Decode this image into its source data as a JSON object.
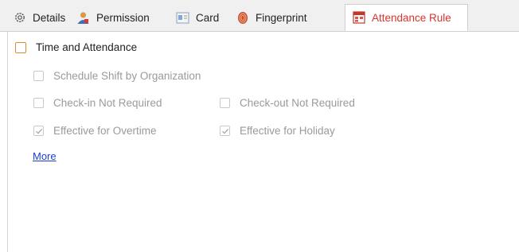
{
  "tabs": [
    {
      "label": "Details",
      "icon": "gear-icon"
    },
    {
      "label": "Permission",
      "icon": "user-permission-icon"
    },
    {
      "label": "Card",
      "icon": "card-icon"
    },
    {
      "label": "Fingerprint",
      "icon": "fingerprint-icon"
    },
    {
      "label": "Attendance Rule",
      "icon": "attendance-rule-icon",
      "active": true
    }
  ],
  "main_option": {
    "label": "Time and Attendance",
    "checked": false
  },
  "options": [
    {
      "label": "Schedule Shift by Organization",
      "checked": false
    },
    {
      "label": "Check-in Not Required",
      "checked": false
    },
    {
      "label": "Check-out Not Required",
      "checked": false
    },
    {
      "label": "Effective for Overtime",
      "checked": true
    },
    {
      "label": "Effective for Holiday",
      "checked": true
    }
  ],
  "more_link": "More",
  "colors": {
    "active_tab": "#d9342b",
    "accent_checkbox": "#e08a2e",
    "link": "#1a3fd4",
    "disabled_text": "#9a9a9a"
  }
}
